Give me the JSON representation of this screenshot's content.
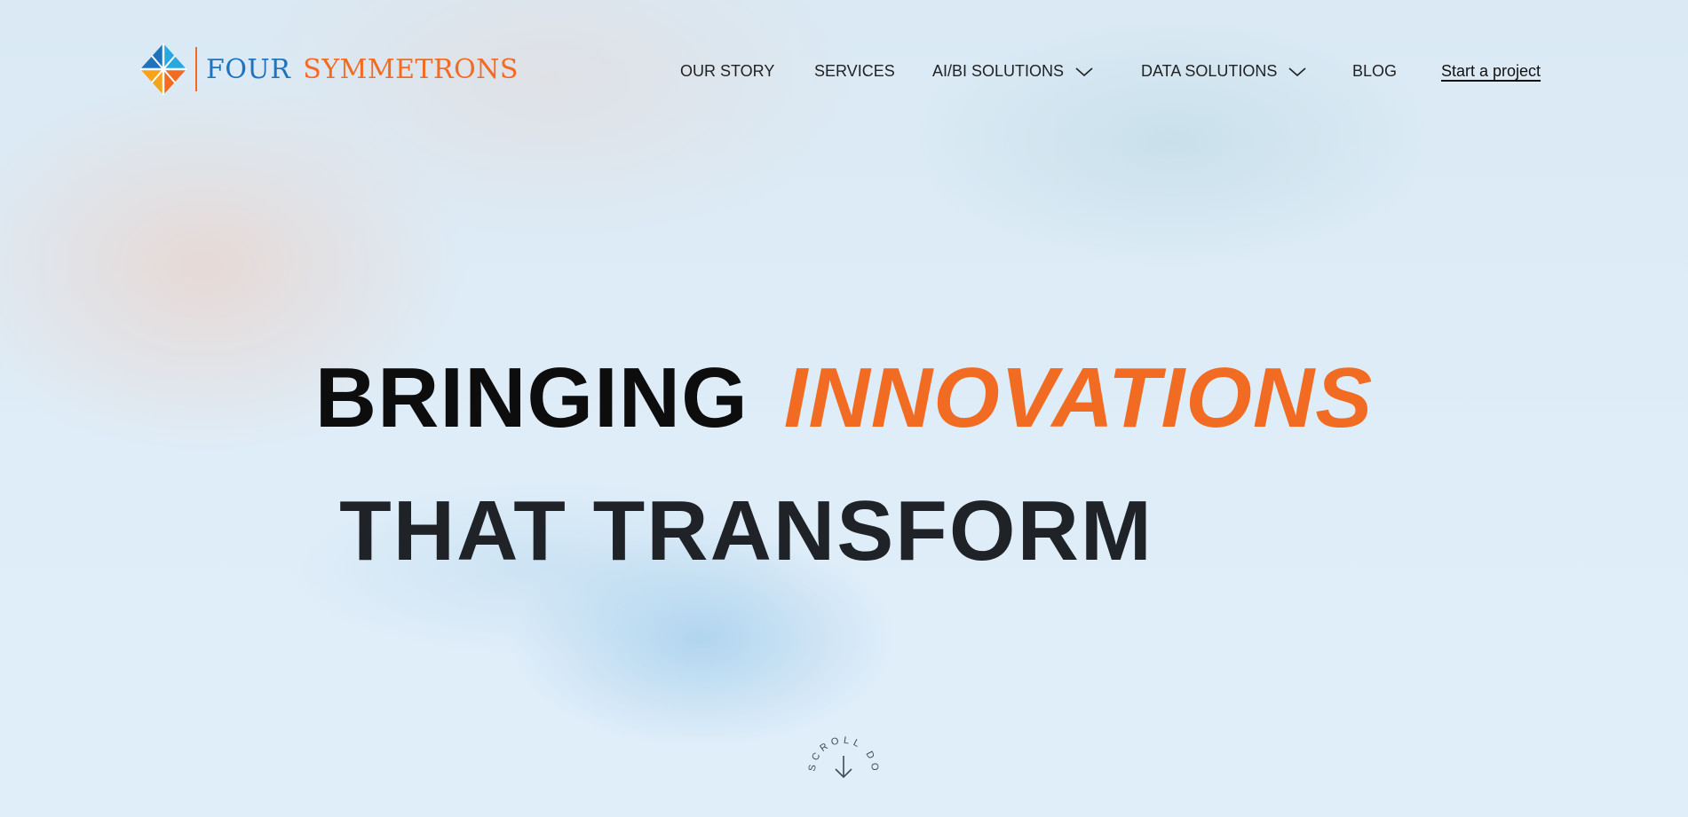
{
  "brand": {
    "word1": "FOUR",
    "word2": "SYMMETRONS",
    "colors": {
      "blue": "#1e73be",
      "orange": "#f26b22"
    }
  },
  "nav": {
    "our_story": "OUR STORY",
    "services": "SERVICES",
    "ai_bi": "AI/BI SOLUTIONS",
    "data": "DATA SOLUTIONS",
    "blog": "BLOG",
    "cta": "Start a project"
  },
  "hero": {
    "word1": "BRINGING",
    "word2": "INNOVATIONS",
    "line2": "THAT TRANSFORM"
  },
  "scroll": {
    "label": "SCROLL DOWN",
    "icon": "arrow-down-icon"
  }
}
